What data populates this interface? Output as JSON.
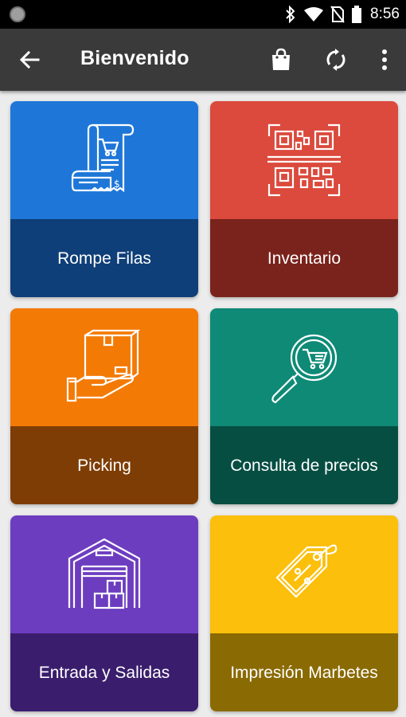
{
  "status_bar": {
    "time": "8:56"
  },
  "toolbar": {
    "title": "Bienvenido",
    "icons": [
      "back-arrow-icon",
      "shopping-bag-icon",
      "sync-icon",
      "more-vert-icon"
    ]
  },
  "tiles": [
    {
      "label": "Rompe Filas",
      "icon": "receipt-cart-icon",
      "color_top": "#1e77d8",
      "color_bottom": "#0f3f78"
    },
    {
      "label": "Inventario",
      "icon": "qr-scan-icon",
      "color_top": "#db4a3c",
      "color_bottom": "#7a231c"
    },
    {
      "label": "Picking",
      "icon": "hand-box-icon",
      "color_top": "#f37a05",
      "color_bottom": "#7e3d04"
    },
    {
      "label": "Consulta de precios",
      "icon": "magnifier-cart-icon",
      "color_top": "#0e8a76",
      "color_bottom": "#064e42"
    },
    {
      "label": "Entrada y Salidas",
      "icon": "warehouse-icon",
      "color_top": "#6d3dc0",
      "color_bottom": "#3a1e6d"
    },
    {
      "label": "Impresión Marbetes",
      "icon": "price-tag-icon",
      "color_top": "#fbbf0c",
      "color_bottom": "#8a6a03"
    }
  ]
}
